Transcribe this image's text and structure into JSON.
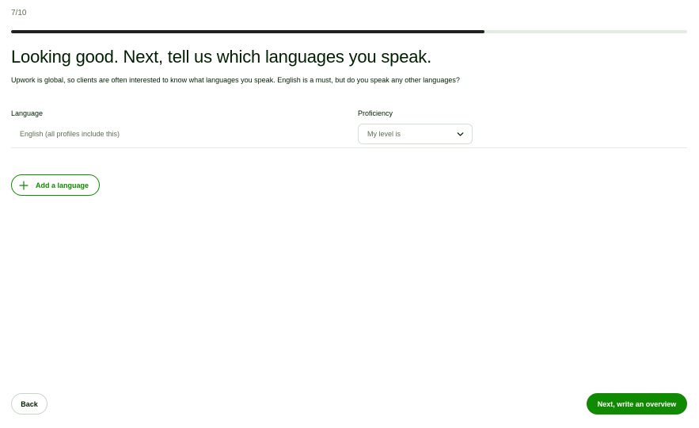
{
  "header": {
    "step_counter": "7/10",
    "progress": 0.7
  },
  "main": {
    "title": "Looking good. Next, tell us which languages you speak.",
    "intro": "Upwork is global, so clients are often interested to know what languages you speak. English is a must, but do you speak any other languages?",
    "columns": {
      "language": "Language",
      "proficiency": "Proficiency"
    },
    "rows": [
      {
        "language": "English (all profiles include this)",
        "proficiency_placeholder": "My level is"
      }
    ],
    "add_language_label": "Add a language"
  },
  "footer": {
    "back_label": "Back",
    "next_label": "Next, write an overview"
  },
  "colors": {
    "brand_green": "#108a00",
    "progress_fill": "#222222",
    "progress_track": "#e4ebe4"
  },
  "icons": {
    "select": "chevron-down-icon",
    "add": "plus-icon"
  }
}
